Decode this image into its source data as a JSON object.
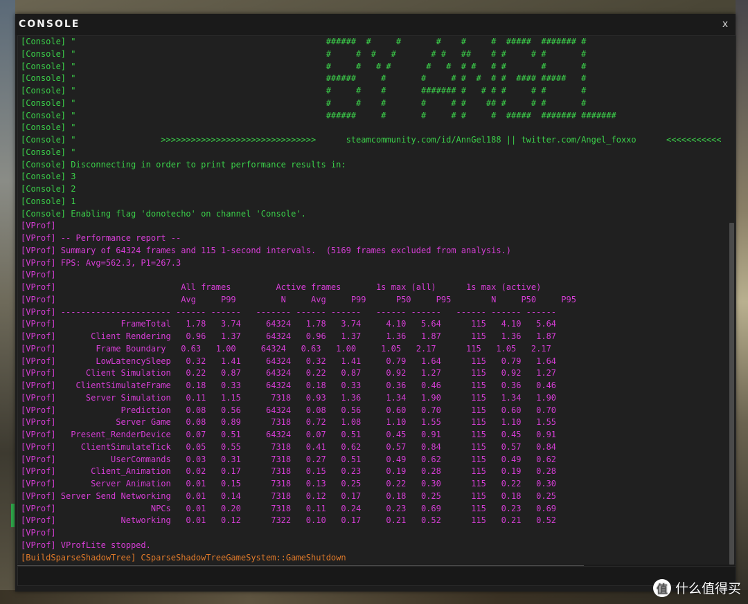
{
  "window": {
    "title": "CONSOLE",
    "close_label": "x"
  },
  "colors": {
    "console_tag": "#3bd04a",
    "vprof_tag": "#d63ed6",
    "build_tag": "#e07a2a",
    "background": "#202020"
  },
  "lines": [
    {
      "type": "console",
      "text": "[Console] \"                                                  ######  #     #       #    #     #  #####  ####### #"
    },
    {
      "type": "console",
      "text": "[Console] \"                                                  #     #  #   #       # #   ##    # #     # #       #"
    },
    {
      "type": "console",
      "text": "[Console] \"                                                  #     #   # #       #   #  # #   # #       #       #"
    },
    {
      "type": "console",
      "text": "[Console] \"                                                  ######     #       #     # #  #  # #  #### #####   #"
    },
    {
      "type": "console",
      "text": "[Console] \"                                                  #     #    #       ####### #   # # #     # #       #"
    },
    {
      "type": "console",
      "text": "[Console] \"                                                  #     #    #       #     # #    ## #     # #       #"
    },
    {
      "type": "console",
      "text": "[Console] \"                                                  ######     #       #     # #     #  #####  ####### #######"
    },
    {
      "type": "console",
      "text": "[Console] \""
    },
    {
      "type": "console",
      "text": "[Console] \"                 >>>>>>>>>>>>>>>>>>>>>>>>>>>>>>>      steamcommunity.com/id/AnnGel188 || twitter.com/Angel_foxxo      <<<<<<<<<<<"
    },
    {
      "type": "console",
      "text": "[Console] \""
    },
    {
      "type": "console",
      "text": "[Console] Disconnecting in order to print performance results in:"
    },
    {
      "type": "console",
      "text": "[Console] 3"
    },
    {
      "type": "console",
      "text": "[Console] 2"
    },
    {
      "type": "console",
      "text": "[Console] 1"
    },
    {
      "type": "console",
      "text": "[Console] Enabling flag 'donotecho' on channel 'Console'."
    },
    {
      "type": "vprof",
      "text": "[VProf]"
    },
    {
      "type": "vprof",
      "text": "[VProf] -- Performance report --"
    },
    {
      "type": "vprof",
      "text": "[VProf] Summary of 64324 frames and 115 1-second intervals.  (5169 frames excluded from analysis.)"
    },
    {
      "type": "vprof",
      "text": "[VProf] FPS: Avg=562.3, P1=267.3"
    },
    {
      "type": "vprof",
      "text": "[VProf]"
    },
    {
      "type": "vprof",
      "text": "[VProf]                         All frames         Active frames       1s max (all)      1s max (active)"
    },
    {
      "type": "vprof",
      "text": "[VProf]                         Avg     P99         N     Avg     P99      P50     P95        N     P50     P95"
    },
    {
      "type": "vprof",
      "text": "[VProf] ---------------------- ------ ------   ------- ------ ------   ------ ------   ------ ------ ------"
    },
    {
      "type": "vprof",
      "text": "[VProf]             FrameTotal   1.78   3.74     64324   1.78   3.74     4.10   5.64      115   4.10   5.64"
    },
    {
      "type": "vprof",
      "text": "[VProf]       Client Rendering   0.96   1.37     64324   0.96   1.37     1.36   1.87      115   1.36   1.87"
    },
    {
      "type": "vprof",
      "text": "[VProf]        Frame Boundary   0.63   1.00     64324   0.63   1.00     1.05   2.17      115   1.05   2.17"
    },
    {
      "type": "vprof",
      "text": "[VProf]        LowLatencySleep   0.32   1.41     64324   0.32   1.41     0.79   1.64      115   0.79   1.64"
    },
    {
      "type": "vprof",
      "text": "[VProf]      Client Simulation   0.22   0.87     64324   0.22   0.87     0.92   1.27      115   0.92   1.27"
    },
    {
      "type": "vprof",
      "text": "[VProf]    ClientSimulateFrame   0.18   0.33     64324   0.18   0.33     0.36   0.46      115   0.36   0.46"
    },
    {
      "type": "vprof",
      "text": "[VProf]      Server Simulation   0.11   1.15      7318   0.93   1.36     1.34   1.90      115   1.34   1.90"
    },
    {
      "type": "vprof",
      "text": "[VProf]             Prediction   0.08   0.56     64324   0.08   0.56     0.60   0.70      115   0.60   0.70"
    },
    {
      "type": "vprof",
      "text": "[VProf]            Server Game   0.08   0.89      7318   0.72   1.08     1.10   1.55      115   1.10   1.55"
    },
    {
      "type": "vprof",
      "text": "[VProf]   Present_RenderDevice   0.07   0.51     64324   0.07   0.51     0.45   0.91      115   0.45   0.91"
    },
    {
      "type": "vprof",
      "text": "[VProf]     ClientSimulateTick   0.05   0.55      7318   0.41   0.62     0.57   0.84      115   0.57   0.84"
    },
    {
      "type": "vprof",
      "text": "[VProf]           UserCommands   0.03   0.31      7318   0.27   0.51     0.49   0.62      115   0.49   0.62"
    },
    {
      "type": "vprof",
      "text": "[VProf]       Client_Animation   0.02   0.17      7318   0.15   0.23     0.19   0.28      115   0.19   0.28"
    },
    {
      "type": "vprof",
      "text": "[VProf]       Server Animation   0.01   0.15      7318   0.13   0.25     0.22   0.30      115   0.22   0.30"
    },
    {
      "type": "vprof",
      "text": "[VProf] Server Send Networking   0.01   0.14      7318   0.12   0.17     0.18   0.25      115   0.18   0.25"
    },
    {
      "type": "vprof",
      "text": "[VProf]                   NPCs   0.01   0.20      7318   0.11   0.24     0.23   0.69      115   0.23   0.69"
    },
    {
      "type": "vprof",
      "text": "[VProf]             Networking   0.01   0.12      7322   0.10   0.17     0.21   0.52      115   0.21   0.52"
    },
    {
      "type": "vprof",
      "text": "[VProf]"
    },
    {
      "type": "vprof",
      "text": "[VProf] VProfLite stopped."
    },
    {
      "type": "build",
      "text": "[BuildSparseShadowTree] CSparseShadowTreeGameSystem::GameShutdown"
    }
  ],
  "input": {
    "value": "",
    "placeholder": ""
  },
  "watermark": {
    "logo_glyph": "值",
    "text": "什么值得买"
  }
}
